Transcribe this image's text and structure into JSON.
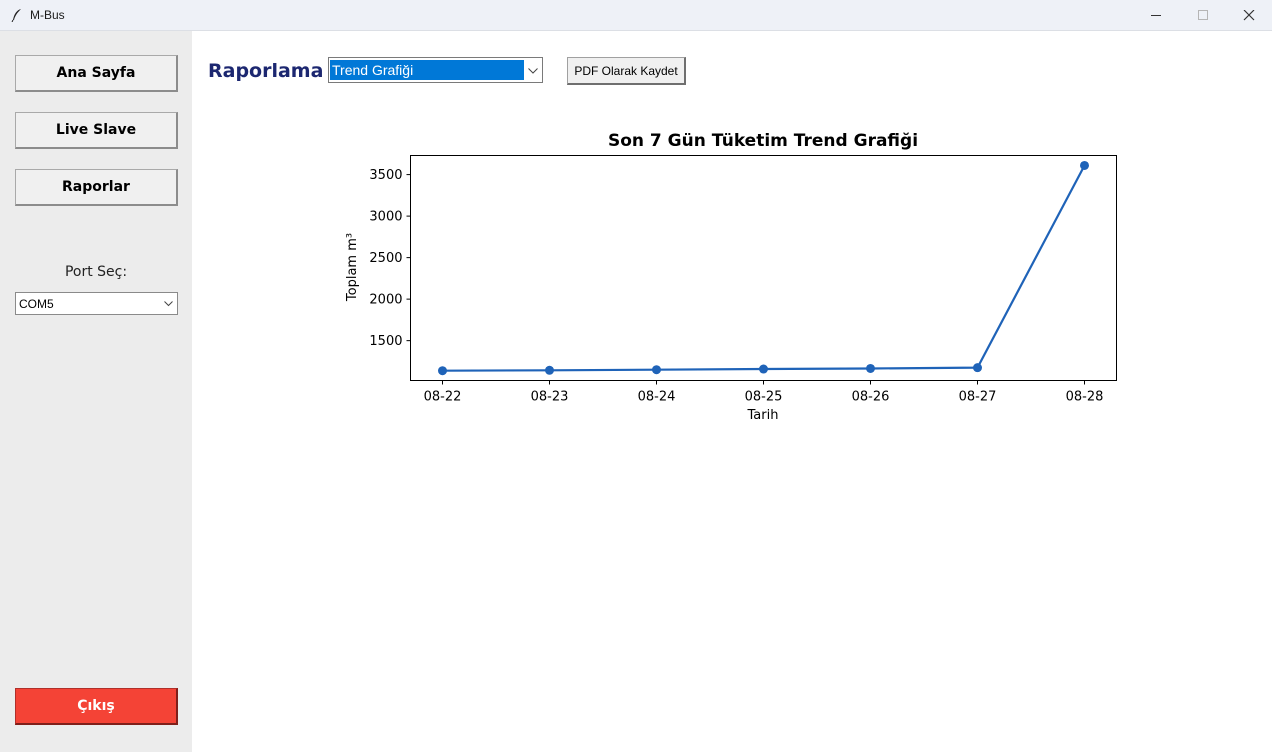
{
  "window": {
    "title": "M-Bus"
  },
  "sidebar": {
    "nav": [
      "Ana Sayfa",
      "Live Slave",
      "Raporlar"
    ],
    "port_label": "Port Seç:",
    "port_value": "COM5",
    "exit_label": "Çıkış"
  },
  "report": {
    "title": "Raporlama",
    "type_value": "Trend Grafiği",
    "pdf_button": "PDF Olarak Kaydet"
  },
  "colors": {
    "accent": "#1c2770",
    "exit": "#f44336",
    "line": "#1f63b8",
    "selection": "#0078d7"
  },
  "chart_data": {
    "type": "line",
    "title": "Son 7 Gün Tüketim Trend Grafiği",
    "xlabel": "Tarih",
    "ylabel": "Toplam m³",
    "x": [
      "08-22",
      "08-23",
      "08-24",
      "08-25",
      "08-26",
      "08-27",
      "08-28"
    ],
    "series": [
      {
        "values": [
          1138,
          1143,
          1150,
          1158,
          1165,
          1175,
          3610
        ]
      }
    ],
    "yticks": [
      1500,
      2000,
      2500,
      3000,
      3500
    ],
    "ylim": [
      1020,
      3730
    ],
    "grid": false
  }
}
